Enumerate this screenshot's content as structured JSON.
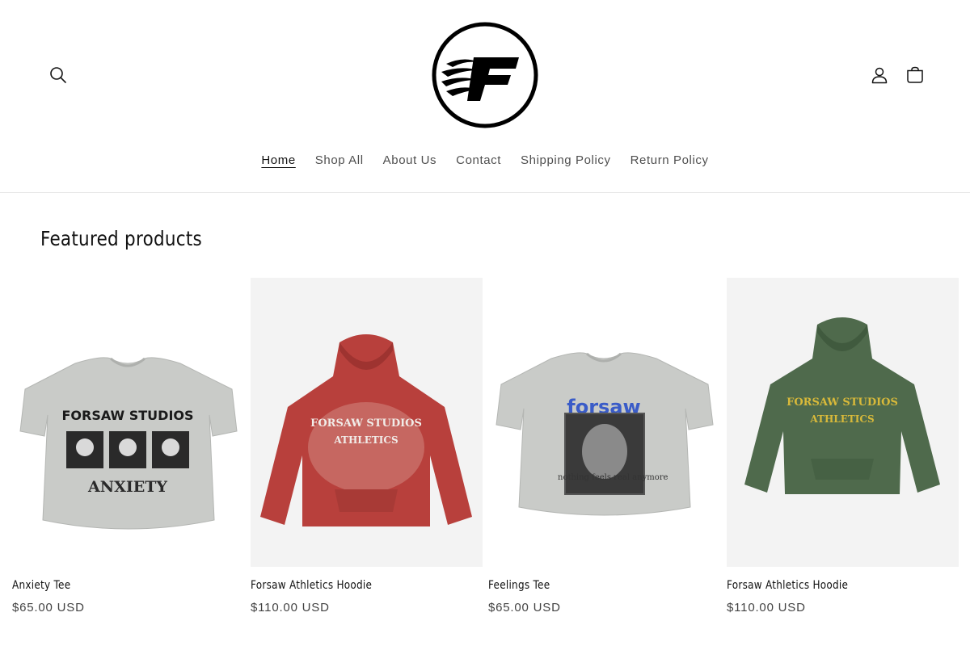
{
  "header": {
    "logo_letter": "F",
    "nav": [
      {
        "label": "Home",
        "active": true
      },
      {
        "label": "Shop All",
        "active": false
      },
      {
        "label": "About Us",
        "active": false
      },
      {
        "label": "Contact",
        "active": false
      },
      {
        "label": "Shipping Policy",
        "active": false
      },
      {
        "label": "Return Policy",
        "active": false
      }
    ],
    "icons": {
      "search": "search-icon",
      "account": "account-icon",
      "cart": "cart-icon"
    }
  },
  "featured": {
    "title": "Featured products",
    "products": [
      {
        "name": "Anxiety Tee",
        "price": "$65.00 USD",
        "print_top": "FORSAW STUDIOS",
        "print_bottom": "ANXIETY",
        "garment_color": "#c9cbc8"
      },
      {
        "name": "Forsaw Athletics Hoodie",
        "price": "$110.00 USD",
        "print_top": "FORSAW STUDIOS",
        "print_bottom": "ATHLETICS",
        "garment_color": "#b8403c"
      },
      {
        "name": "Feelings Tee",
        "price": "$65.00 USD",
        "print_top": "forsaw",
        "print_bottom": "nothing feels real anymore",
        "garment_color": "#c9cbc8"
      },
      {
        "name": "Forsaw Athletics Hoodie",
        "price": "$110.00 USD",
        "print_top": "FORSAW STUDIOS",
        "print_bottom": "ATHLETICS",
        "garment_color": "#4f6a4c"
      }
    ]
  }
}
